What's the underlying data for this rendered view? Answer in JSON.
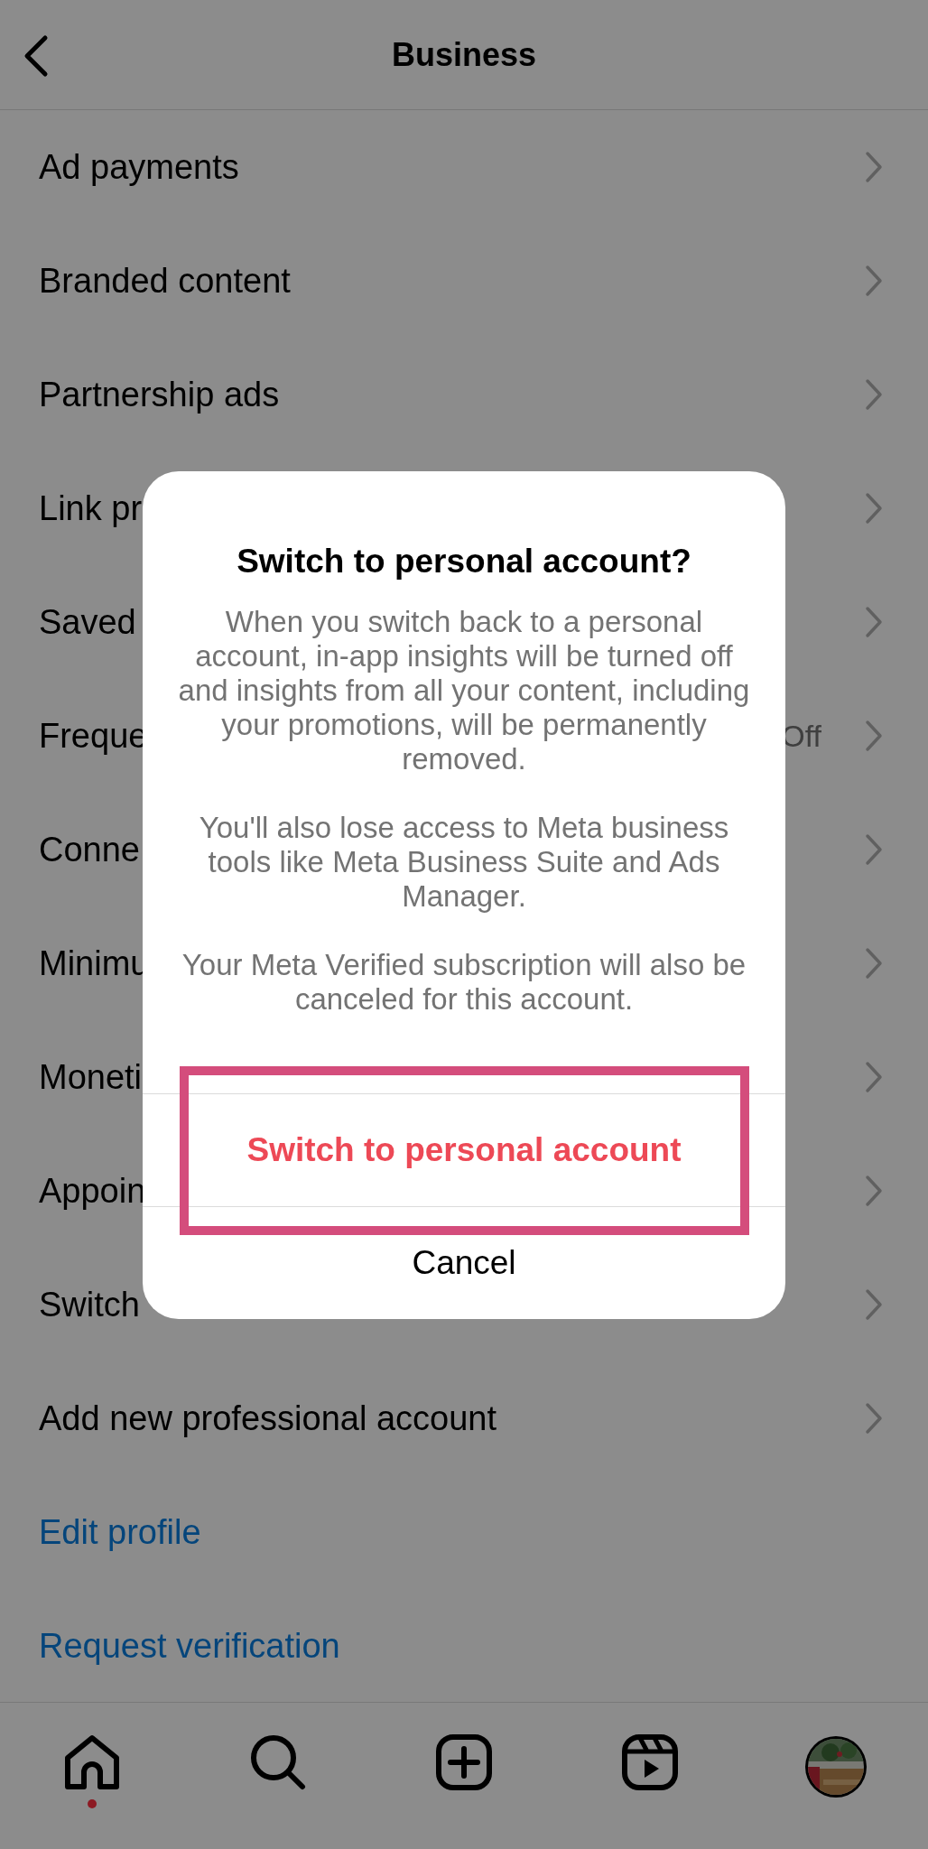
{
  "header": {
    "title": "Business"
  },
  "rows": [
    {
      "kind": "nav",
      "label": "Ad payments"
    },
    {
      "kind": "nav",
      "label": "Branded content"
    },
    {
      "kind": "nav",
      "label": "Partnership ads"
    },
    {
      "kind": "nav",
      "label": "Link pr"
    },
    {
      "kind": "nav",
      "label": "Saved"
    },
    {
      "kind": "nav",
      "label": "Freque",
      "value": "Off"
    },
    {
      "kind": "nav",
      "label": "Conne"
    },
    {
      "kind": "nav",
      "label": "Minimu"
    },
    {
      "kind": "nav",
      "label": "Moneti"
    },
    {
      "kind": "nav",
      "label": "Appoin"
    },
    {
      "kind": "nav",
      "label": "Switch"
    },
    {
      "kind": "nav",
      "label": "Add new professional account"
    },
    {
      "kind": "link",
      "label": "Edit profile"
    },
    {
      "kind": "link",
      "label": "Request verification"
    }
  ],
  "dialog": {
    "title": "Switch to personal account?",
    "paragraphs": [
      "When you switch back to a personal account, in-app insights will be turned off and insights from all your content, including your promotions, will be permanently removed.",
      "You'll also lose access to Meta business tools like Meta Business Suite and Ads Manager.",
      "Your Meta Verified subscription will also be canceled for this account."
    ],
    "actions": [
      {
        "kind": "destructive",
        "label": "Switch to personal account",
        "highlighted": true
      },
      {
        "kind": "default",
        "label": "Cancel",
        "highlighted": false
      }
    ]
  },
  "bottom_nav": [
    {
      "kind": "home",
      "dot": true
    },
    {
      "kind": "search",
      "dot": false
    },
    {
      "kind": "create",
      "dot": false
    },
    {
      "kind": "reels",
      "dot": false
    },
    {
      "kind": "profile",
      "dot": false
    }
  ]
}
